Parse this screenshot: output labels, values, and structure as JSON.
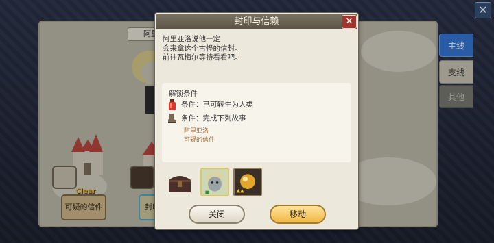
{
  "background_map": {
    "title_tab": "阿里",
    "nodes": [
      {
        "label": "可疑的信件",
        "status": "Clear"
      },
      {
        "label": "封印"
      }
    ]
  },
  "side_tabs": [
    {
      "label": "主线",
      "state": "active"
    },
    {
      "label": "支线",
      "state": "normal"
    },
    {
      "label": "其他",
      "state": "disabled"
    }
  ],
  "top_close_label": "✕",
  "dialog": {
    "title": "封印与信赖",
    "close_label": "✕",
    "description": [
      "阿里亚洛说他一定",
      "会来拿这个古怪的信封。",
      "前往瓦梅尔等待看看吧。"
    ],
    "conditions_title": "解锁条件",
    "conditions": [
      {
        "icon": "potion-icon",
        "text": "条件：已可转生为人类"
      },
      {
        "icon": "boot-icon",
        "text": "条件：完成下列故事"
      }
    ],
    "required_stories": [
      "阿里亚洛",
      "可疑的信件"
    ],
    "rewards": [
      {
        "icon": "treasure-chest-icon"
      },
      {
        "icon": "character-portrait-icon"
      },
      {
        "icon": "golden-orb-icon"
      }
    ],
    "buttons": {
      "close": "关闭",
      "move": "移动"
    }
  },
  "colors": {
    "accent_blue": "#2f6cc4",
    "dialog_header": "#5b5446",
    "close_red": "#a0372f",
    "move_button": "#f0b846",
    "story_text": "#a36b3a"
  }
}
